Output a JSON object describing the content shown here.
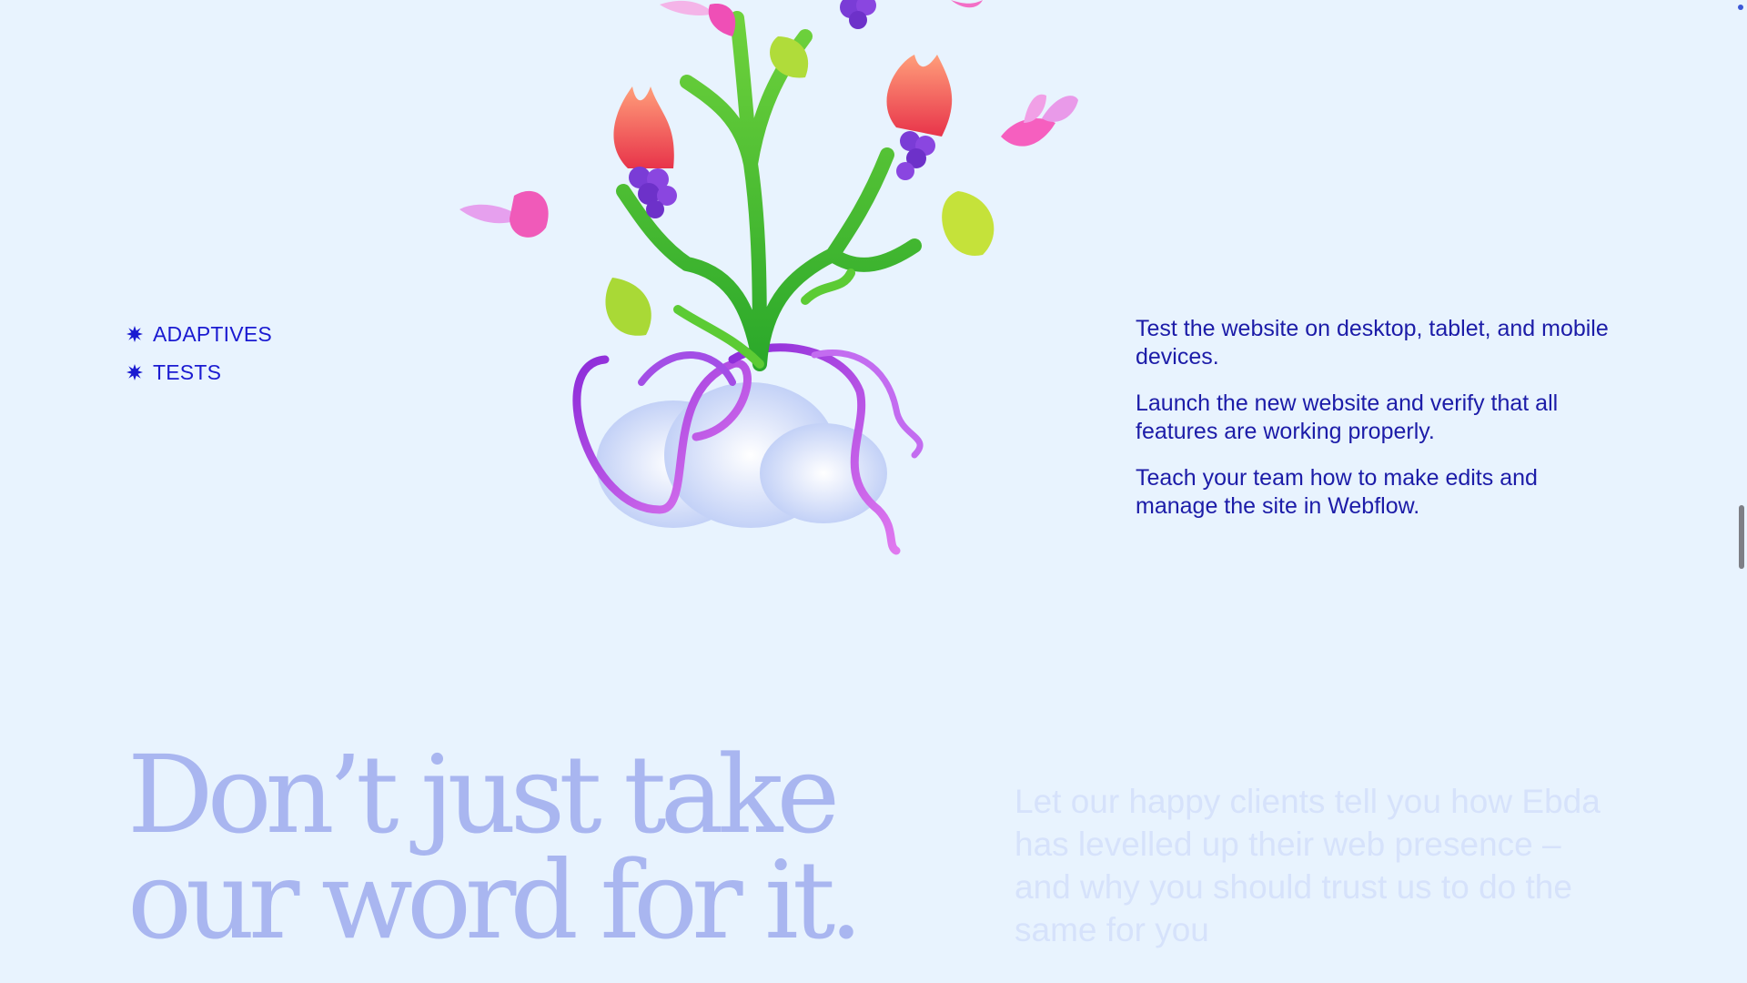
{
  "features": {
    "items": [
      {
        "label": "ADAPTIVES"
      },
      {
        "label": "TESTS"
      }
    ],
    "bullet_icon": "starburst-icon",
    "color": "#1a1ad1"
  },
  "descriptions": {
    "paragraphs": [
      {
        "text": "Test the website on desktop, tablet, and mobile devices."
      },
      {
        "text": "Launch the new website and verify that all features are working properly."
      },
      {
        "text": "Teach your team how to make edits and manage the site in Webflow."
      }
    ],
    "color": "#1c1ca8"
  },
  "illustration": {
    "icon": "floral-sculpture-illustration"
  },
  "testimonials_intro": {
    "headline_line1": "Don’t just take",
    "headline_line2": "our word for it.",
    "subcopy": "Let our happy clients tell you how Ebda has levelled up their web presence – and why you should trust us to do the same for you",
    "headline_color": "#a9b6f0",
    "subcopy_color": "#d6e2fb"
  },
  "theme": {
    "background": "#e8f3fe"
  }
}
